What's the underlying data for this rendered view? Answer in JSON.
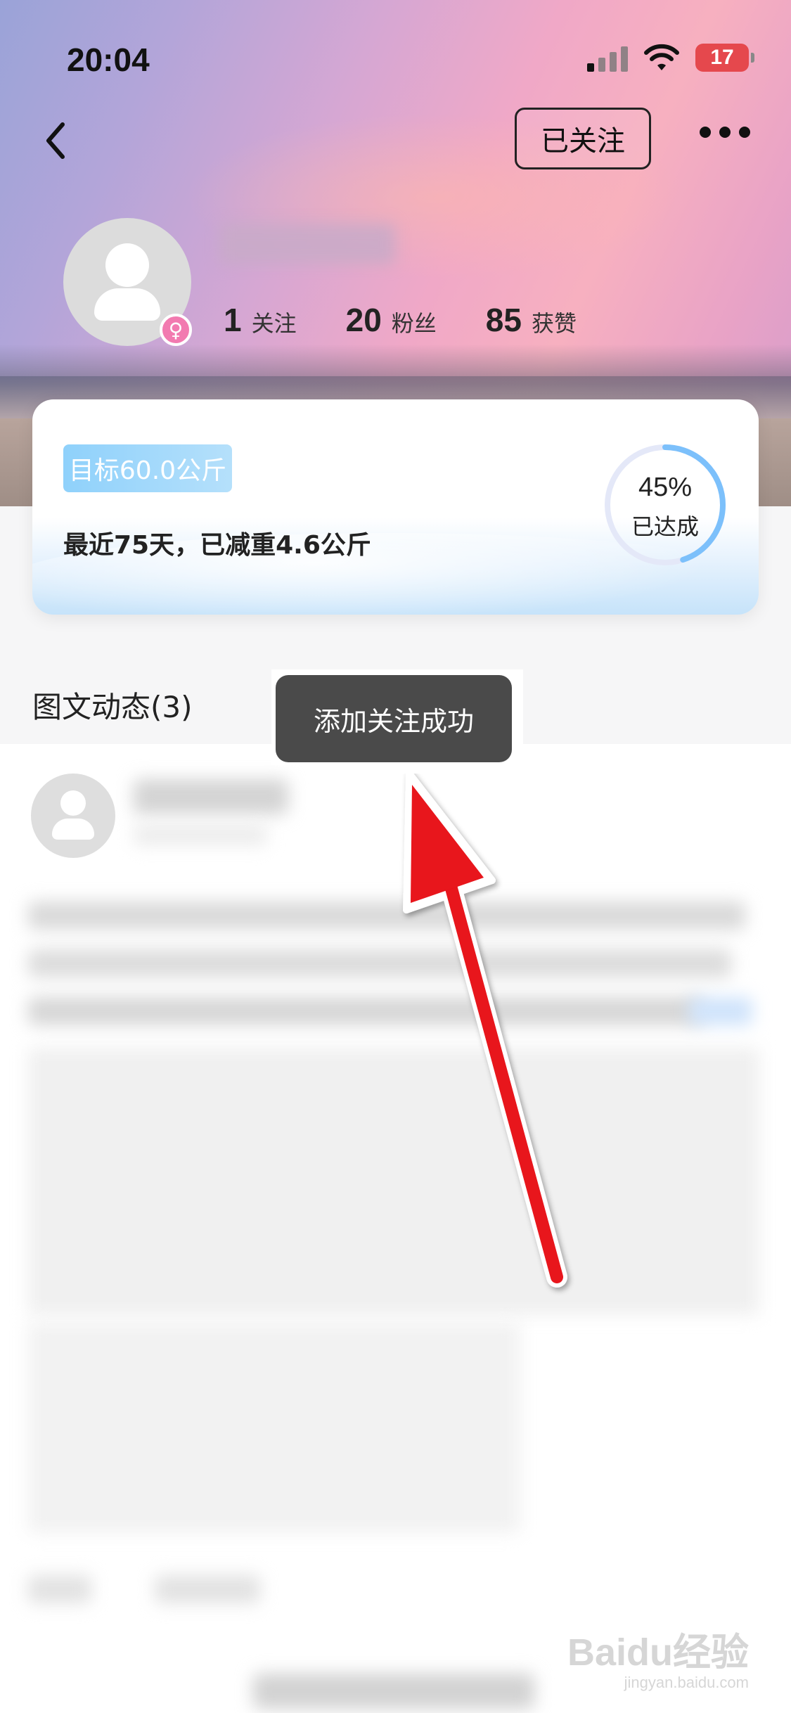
{
  "status_bar": {
    "time": "20:04",
    "battery": "17"
  },
  "nav": {
    "follow_label": "已关注"
  },
  "profile": {
    "stats": [
      {
        "value": "1",
        "label": "关注"
      },
      {
        "value": "20",
        "label": "粉丝"
      },
      {
        "value": "85",
        "label": "获赞"
      }
    ]
  },
  "goal_card": {
    "target_tag": "目标60.0公斤",
    "progress_text": "最近75天，已减重4.6公斤",
    "percent": "45%",
    "percent_value": 45,
    "percent_label": "已达成"
  },
  "section": {
    "title": "图文动态(3)"
  },
  "toast": {
    "message": "添加关注成功"
  },
  "watermark": {
    "brand": "Baidu经验",
    "url": "jingyan.baidu.com"
  },
  "colors": {
    "accent_blue": "#7cc0fb",
    "annotation_arrow": "#e8121b",
    "toast_bg": "#4a4a4a"
  }
}
